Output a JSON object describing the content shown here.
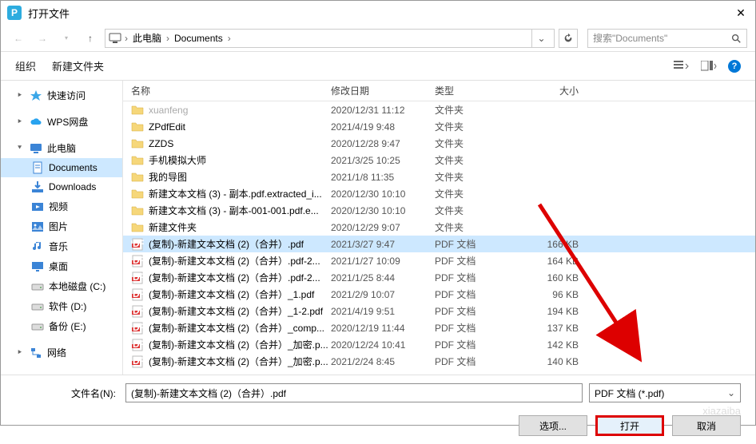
{
  "window": {
    "title": "打开文件"
  },
  "breadcrumb": {
    "loc1": "此电脑",
    "loc2": "Documents"
  },
  "search": {
    "placeholder": "搜索\"Documents\""
  },
  "toolbar": {
    "organize": "组织",
    "newfolder": "新建文件夹"
  },
  "columns": {
    "name": "名称",
    "date": "修改日期",
    "type": "类型",
    "size": "大小"
  },
  "sidebar": [
    {
      "label": "快速访问",
      "icon": "star",
      "color": "#3ba7e8",
      "exp": true
    },
    {
      "label": "WPS网盘",
      "icon": "cloud",
      "color": "#28a3ef",
      "exp": true
    },
    {
      "label": "此电脑",
      "icon": "monitor",
      "color": "#3b84d6",
      "exp": true,
      "open": true
    },
    {
      "label": "Documents",
      "icon": "doc",
      "color": "#3b84d6",
      "sel": true,
      "indent": true
    },
    {
      "label": "Downloads",
      "icon": "download",
      "color": "#3b84d6",
      "indent": true
    },
    {
      "label": "视频",
      "icon": "video",
      "color": "#3b84d6",
      "indent": true
    },
    {
      "label": "图片",
      "icon": "image",
      "color": "#3b84d6",
      "indent": true
    },
    {
      "label": "音乐",
      "icon": "music",
      "color": "#3b84d6",
      "indent": true
    },
    {
      "label": "桌面",
      "icon": "desktop",
      "color": "#3b84d6",
      "indent": true
    },
    {
      "label": "本地磁盘 (C:)",
      "icon": "drive",
      "color": "#888",
      "indent": true
    },
    {
      "label": "软件 (D:)",
      "icon": "drive",
      "color": "#888",
      "indent": true
    },
    {
      "label": "备份 (E:)",
      "icon": "drive",
      "color": "#888",
      "indent": true
    },
    {
      "label": "网络",
      "icon": "network",
      "color": "#3b84d6",
      "exp": true
    }
  ],
  "files": [
    {
      "name": "xuanfeng",
      "date": "2020/12/31 11:12",
      "type": "文件夹",
      "size": "",
      "ico": "folder",
      "dim": true
    },
    {
      "name": "ZPdfEdit",
      "date": "2021/4/19 9:48",
      "type": "文件夹",
      "size": "",
      "ico": "folder"
    },
    {
      "name": "ZZDS",
      "date": "2020/12/28 9:47",
      "type": "文件夹",
      "size": "",
      "ico": "folder"
    },
    {
      "name": "手机模拟大师",
      "date": "2021/3/25 10:25",
      "type": "文件夹",
      "size": "",
      "ico": "folder"
    },
    {
      "name": "我的导图",
      "date": "2021/1/8 11:35",
      "type": "文件夹",
      "size": "",
      "ico": "folder"
    },
    {
      "name": "新建文本文档 (3) - 副本.pdf.extracted_i...",
      "date": "2020/12/30 10:10",
      "type": "文件夹",
      "size": "",
      "ico": "folder"
    },
    {
      "name": "新建文本文档 (3) - 副本-001-001.pdf.e...",
      "date": "2020/12/30 10:10",
      "type": "文件夹",
      "size": "",
      "ico": "folder"
    },
    {
      "name": "新建文件夹",
      "date": "2020/12/29 9:07",
      "type": "文件夹",
      "size": "",
      "ico": "folder"
    },
    {
      "name": "(复制)-新建文本文档 (2)（合并）.pdf",
      "date": "2021/3/27 9:47",
      "type": "PDF 文档",
      "size": "166 KB",
      "ico": "pdf",
      "sel": true
    },
    {
      "name": "(复制)-新建文本文档 (2)（合并）.pdf-2...",
      "date": "2021/1/27 10:09",
      "type": "PDF 文档",
      "size": "164 KB",
      "ico": "pdf"
    },
    {
      "name": "(复制)-新建文本文档 (2)（合并）.pdf-2...",
      "date": "2021/1/25 8:44",
      "type": "PDF 文档",
      "size": "160 KB",
      "ico": "pdf"
    },
    {
      "name": "(复制)-新建文本文档 (2)（合并）_1.pdf",
      "date": "2021/2/9 10:07",
      "type": "PDF 文档",
      "size": "96 KB",
      "ico": "pdf"
    },
    {
      "name": "(复制)-新建文本文档 (2)（合并）_1-2.pdf",
      "date": "2021/4/19 9:51",
      "type": "PDF 文档",
      "size": "194 KB",
      "ico": "pdf"
    },
    {
      "name": "(复制)-新建文本文档 (2)（合并）_comp...",
      "date": "2020/12/19 11:44",
      "type": "PDF 文档",
      "size": "137 KB",
      "ico": "pdf"
    },
    {
      "name": "(复制)-新建文本文档 (2)（合并）_加密.p...",
      "date": "2020/12/24 10:41",
      "type": "PDF 文档",
      "size": "142 KB",
      "ico": "pdf"
    },
    {
      "name": "(复制)-新建文本文档 (2)（合并）_加密.p...",
      "date": "2021/2/24 8:45",
      "type": "PDF 文档",
      "size": "140 KB",
      "ico": "pdf"
    }
  ],
  "footer": {
    "filename_label": "文件名(N):",
    "filename_value": "(复制)-新建文本文档 (2)（合并）.pdf",
    "filter": "PDF 文档 (*.pdf)",
    "options": "选项...",
    "open": "打开",
    "cancel": "取消"
  },
  "watermark": "xiazaiba"
}
